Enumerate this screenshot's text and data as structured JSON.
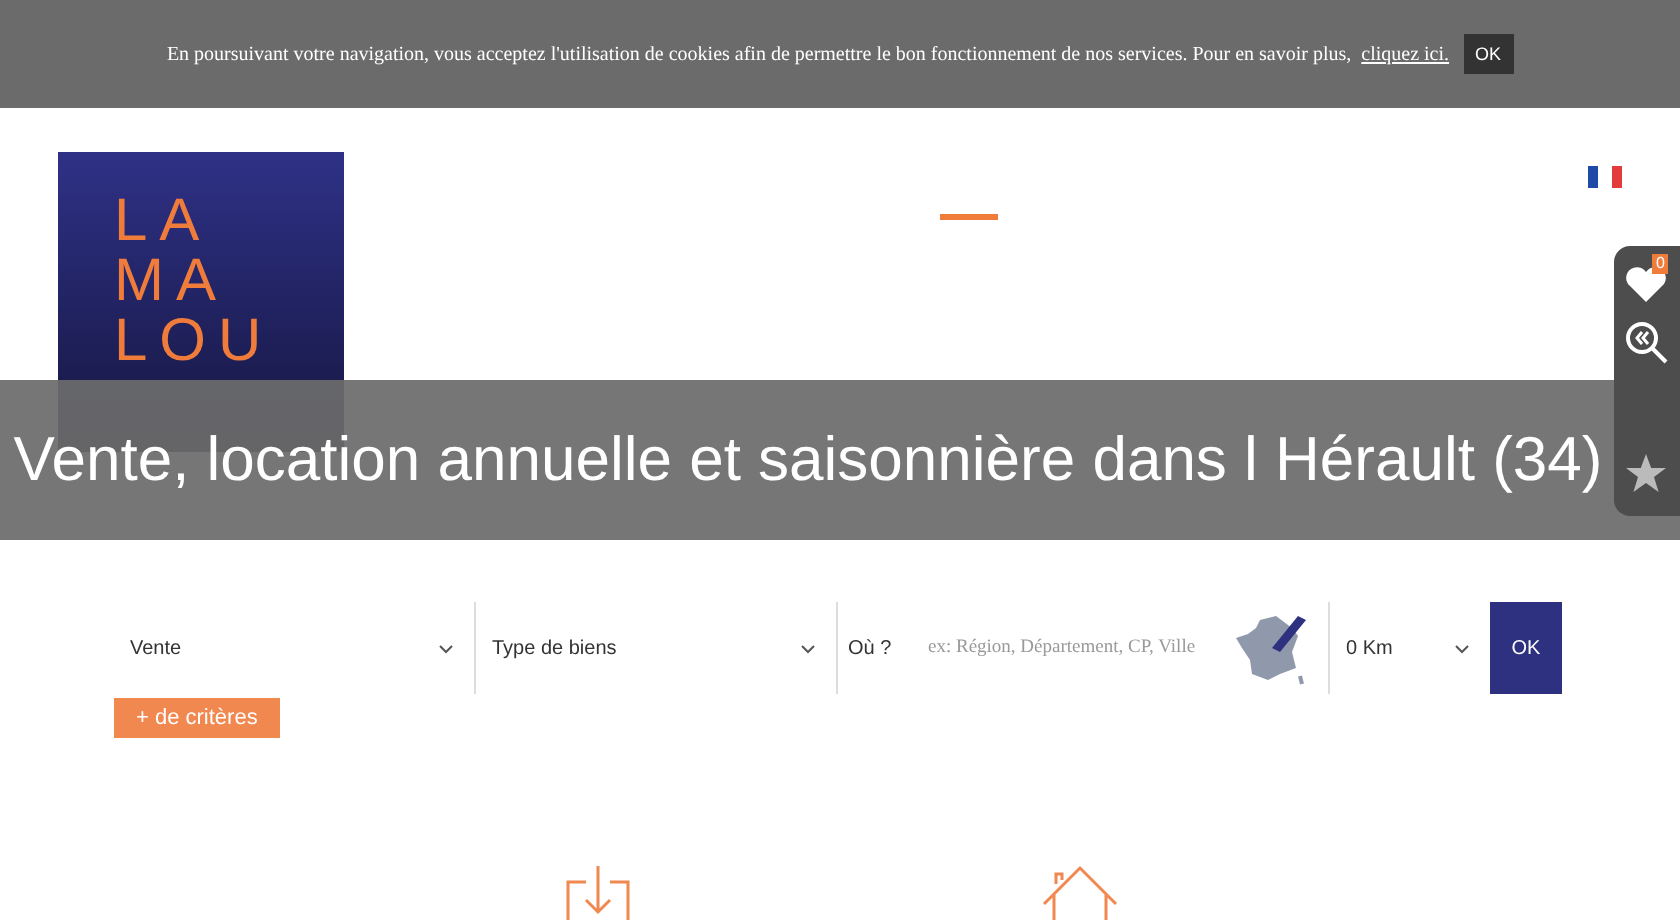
{
  "cookie_banner": {
    "text": "En poursuivant votre navigation, vous acceptez l'utilisation de cookies afin de permettre le bon fonctionnement de nos services. Pour en savoir plus,",
    "link": "cliquez ici.",
    "button": "OK"
  },
  "header": {
    "logo_lines": [
      "LA",
      "MA",
      "LOU"
    ]
  },
  "side_panel": {
    "favorites_count": "0"
  },
  "title": "Vente, location annuelle et saisonnière dans l Hérault (34)",
  "search": {
    "fields": [
      {
        "kind": "select",
        "value": "Vente"
      },
      {
        "kind": "select",
        "value": "Type de biens"
      },
      {
        "kind": "location",
        "label": "Où ?",
        "placeholder": "ex: Région, Département, CP, Ville"
      },
      {
        "kind": "distance",
        "value": "0 Km"
      }
    ],
    "submit": "OK",
    "more_criteria": "+ de critères"
  }
}
